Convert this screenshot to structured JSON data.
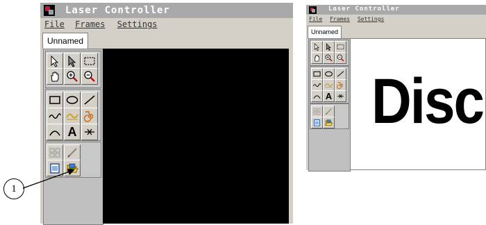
{
  "left_window": {
    "title": "Laser Controller",
    "menu": [
      "File",
      "Frames",
      "Settings"
    ],
    "tab_label": "Unnamed",
    "canvas_color": "#000000"
  },
  "right_window": {
    "title": "Laser Controller",
    "menu": [
      "File",
      "Frames",
      "Settings"
    ],
    "tab_label": "Unnamed",
    "canvas_color": "#ffffff",
    "canvas_text": "Disco"
  },
  "toolbar": {
    "tools": [
      "select-arrow-icon",
      "node-select-icon",
      "rect-select-icon",
      "hand-icon",
      "zoom-in-icon",
      "zoom-out-icon",
      "rectangle-icon",
      "ellipse-icon",
      "line-icon",
      "wave-icon",
      "curve-icon",
      "spiral-icon",
      "arc-icon",
      "text-tool",
      "point-icon",
      "grid-icon",
      "pen-icon",
      "frame-icon",
      "open-folder-icon"
    ],
    "text_tool_glyph": "A"
  },
  "callout": {
    "number": "1"
  }
}
